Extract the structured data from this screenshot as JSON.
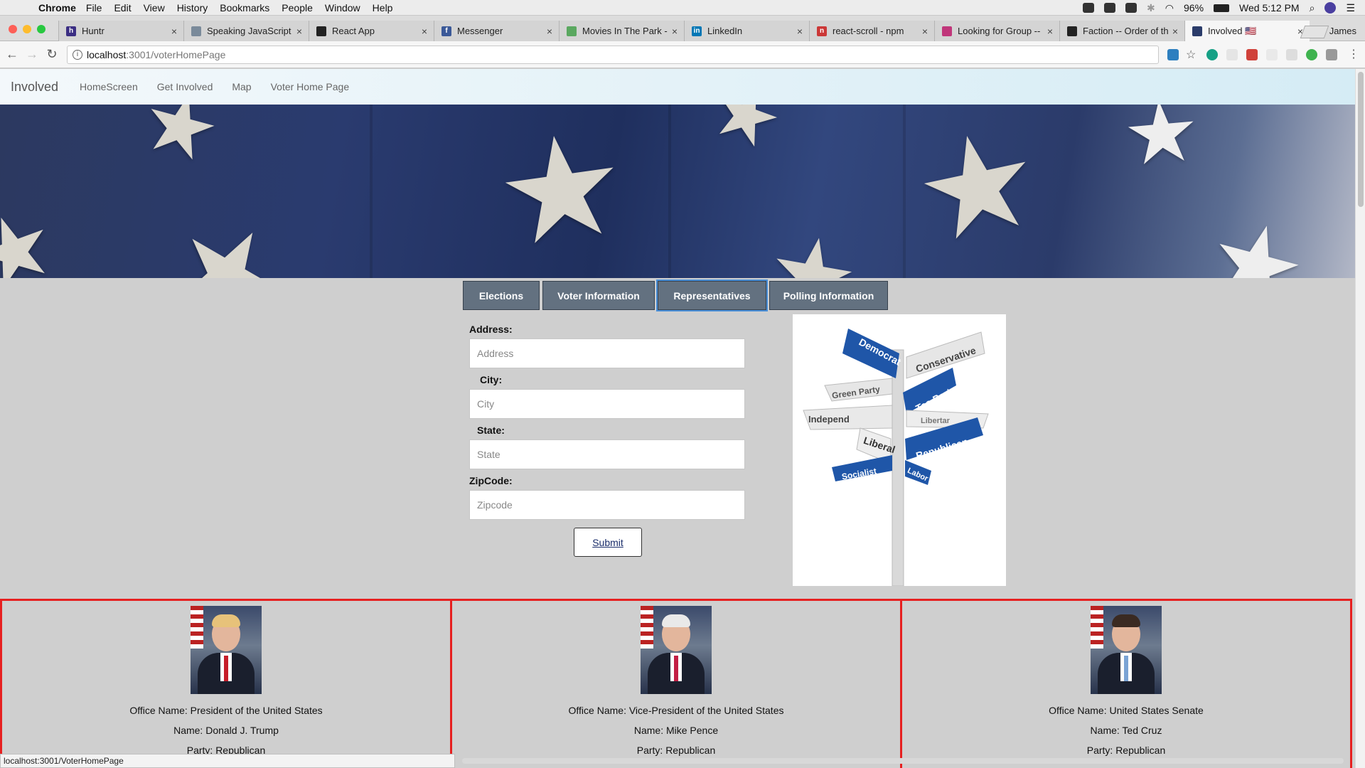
{
  "menubar": {
    "app": "Chrome",
    "items": [
      "File",
      "Edit",
      "View",
      "History",
      "Bookmarks",
      "People",
      "Window",
      "Help"
    ],
    "battery": "96%",
    "clock": "Wed 5:12 PM"
  },
  "tabs": [
    {
      "title": "Huntr",
      "icon": "huntr-favicon",
      "color": "#3b2e83",
      "glyph": "h"
    },
    {
      "title": "Speaking JavaScript",
      "icon": "book-favicon",
      "color": "#7a8a9a",
      "glyph": ""
    },
    {
      "title": "React App",
      "icon": "react-favicon",
      "color": "#222",
      "glyph": ""
    },
    {
      "title": "Messenger",
      "icon": "facebook-favicon",
      "color": "#3b5998",
      "glyph": "f"
    },
    {
      "title": "Movies In The Park -",
      "icon": "park-favicon",
      "color": "#5aa860",
      "glyph": ""
    },
    {
      "title": "LinkedIn",
      "icon": "linkedin-favicon",
      "color": "#0077b5",
      "glyph": "in"
    },
    {
      "title": "react-scroll - npm",
      "icon": "npm-favicon",
      "color": "#cb3837",
      "glyph": "n"
    },
    {
      "title": "Looking for Group --",
      "icon": "lfg-favicon",
      "color": "#c0367a",
      "glyph": ""
    },
    {
      "title": "Faction -- Order of th",
      "icon": "faction-favicon",
      "color": "#222",
      "glyph": ""
    },
    {
      "title": "Involved 🇺🇸",
      "icon": "involved-favicon",
      "color": "#2b3c6a",
      "glyph": ""
    }
  ],
  "profile_name": "James",
  "address_bar": {
    "host": "localhost",
    "path": ":3001/voterHomePage"
  },
  "app_nav": {
    "brand": "Involved",
    "links": [
      "HomeScreen",
      "Get Involved",
      "Map",
      "Voter Home Page"
    ]
  },
  "page_tabs": [
    "Elections",
    "Voter Information",
    "Representatives",
    "Polling Information"
  ],
  "selected_tab": "Representatives",
  "form": {
    "address_label": "Address:",
    "address_placeholder": "Address",
    "city_label": "City:",
    "city_placeholder": "City",
    "state_label": "State:",
    "state_placeholder": "State",
    "zip_label": "ZipCode:",
    "zip_placeholder": "Zipcode",
    "submit": "Submit"
  },
  "signpost": {
    "signs": [
      "Democrat",
      "Conservative",
      "Green Party",
      "Tea Party",
      "Independ",
      "Libertar",
      "Liberal",
      "Republican",
      "Socialist",
      "Labor"
    ]
  },
  "representatives": [
    {
      "office": "Office Name: President of the United States",
      "name": "Name: Donald J. Trump",
      "party": "Party: Republican",
      "tie": "#c61d2a",
      "hair": "#e7c27a"
    },
    {
      "office": "Office Name: Vice-President of the United States",
      "name": "Name: Mike Pence",
      "party": "Party: Republican",
      "tie": "#c21e44",
      "hair": "#e9e9e9"
    },
    {
      "office": "Office Name: United States Senate",
      "name": "Name: Ted Cruz",
      "party": "Party: Republican",
      "tie": "#7aa3d4",
      "hair": "#3a2a22"
    }
  ],
  "status_url": "localhost:3001/VoterHomePage"
}
